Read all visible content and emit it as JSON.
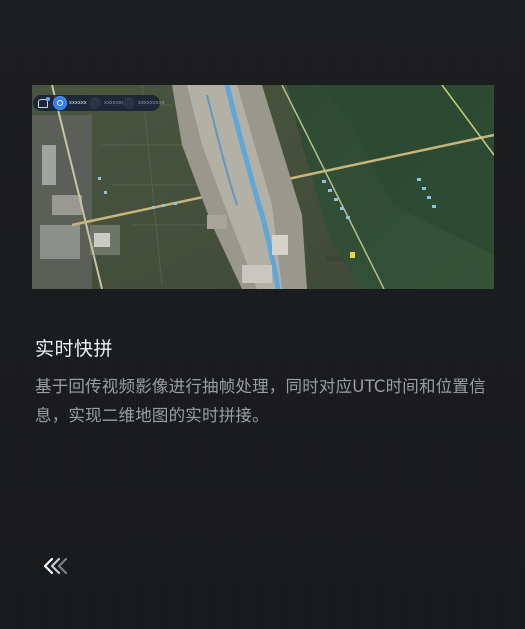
{
  "map": {
    "toolbar": {
      "tool_icon": "drone-icon",
      "labels": [
        "xxxxxx",
        "xxxxxxxxx",
        "xxxxxxxxx"
      ],
      "colors": {
        "active": "#2f7df6",
        "bar": "#121e34"
      }
    },
    "place_label": "xxxxx"
  },
  "feature": {
    "title": "实时快拼",
    "description": "基于回传视频影像进行抽帧处理，同时对应UTC时间和位置信息，实现二维地图的实时拼接。"
  },
  "navigation": {
    "back_icon": "double-chevron-left-icon"
  },
  "colors": {
    "background": "#1a1b1d",
    "title": "#eef0f2",
    "description": "#9a9ea4",
    "accent": "#2f7df6"
  }
}
